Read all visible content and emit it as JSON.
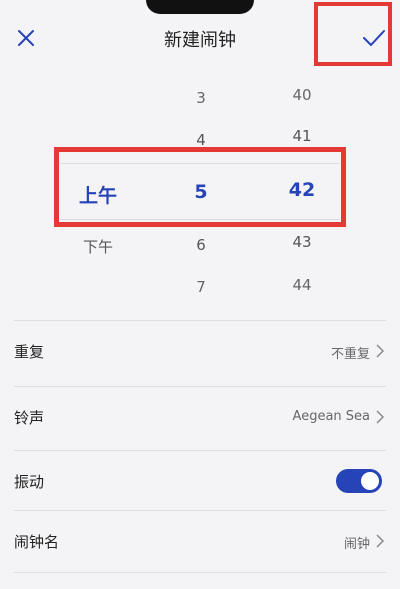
{
  "header": {
    "title": "新建闹钟",
    "close_icon": "close-icon",
    "confirm_icon": "checkmark-icon"
  },
  "picker": {
    "ampm": [
      "上午",
      "下午"
    ],
    "ampm_selected": "上午",
    "hours": [
      "3",
      "4",
      "5",
      "6",
      "7"
    ],
    "hour_selected": "5",
    "minutes": [
      "40",
      "41",
      "42",
      "43",
      "44"
    ],
    "minute_selected": "42"
  },
  "settings": {
    "repeat": {
      "label": "重复",
      "value": "不重复"
    },
    "ringtone": {
      "label": "铃声",
      "value": "Aegean Sea"
    },
    "vibrate": {
      "label": "振动",
      "on": true
    },
    "name": {
      "label": "闹钟名",
      "value": "闹钟"
    }
  },
  "colors": {
    "accent": "#2643b8",
    "highlight_border": "#e53935",
    "background": "#f4f4f6"
  }
}
